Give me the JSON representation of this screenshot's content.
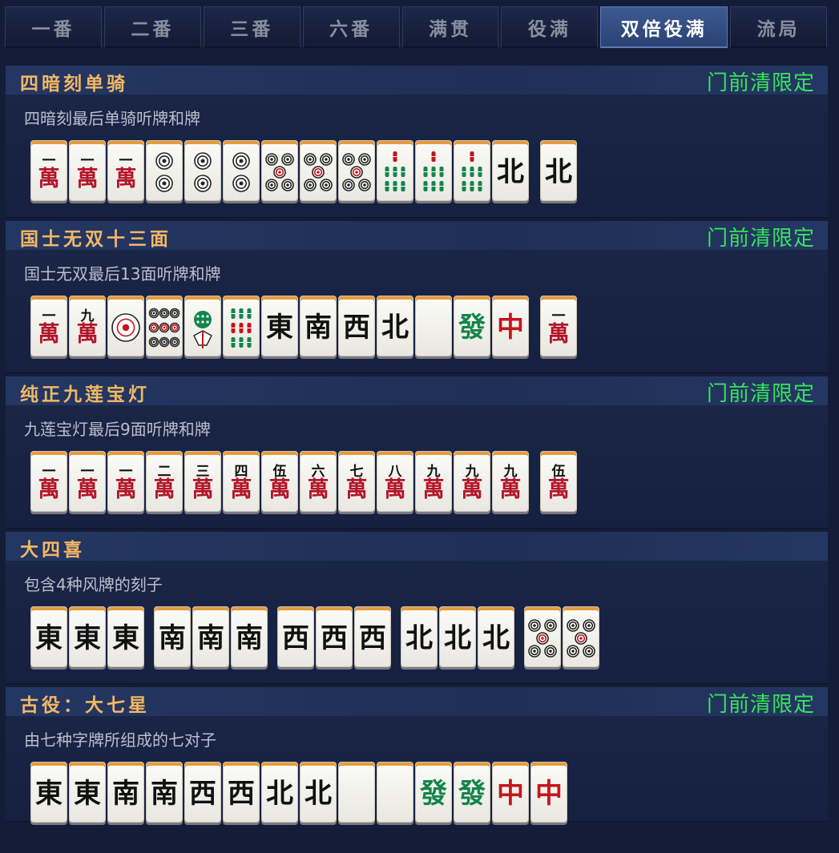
{
  "tabs": [
    {
      "label": "一番",
      "active": false
    },
    {
      "label": "二番",
      "active": false
    },
    {
      "label": "三番",
      "active": false
    },
    {
      "label": "六番",
      "active": false
    },
    {
      "label": "满贯",
      "active": false
    },
    {
      "label": "役满",
      "active": false
    },
    {
      "label": "双倍役满",
      "active": true
    },
    {
      "label": "流局",
      "active": false
    }
  ],
  "sections": [
    {
      "title": "四暗刻单骑",
      "badge": "门前清限定",
      "desc": "四暗刻最后单骑听牌和牌",
      "tiles": [
        [
          [
            "m",
            "一"
          ],
          [
            "m",
            "一"
          ],
          [
            "m",
            "一"
          ],
          [
            "p",
            2
          ],
          [
            "p",
            2
          ],
          [
            "p",
            2
          ],
          [
            "p",
            5
          ],
          [
            "p",
            5
          ],
          [
            "p",
            5
          ],
          [
            "s",
            7
          ],
          [
            "s",
            7
          ],
          [
            "s",
            7
          ],
          [
            "z",
            "北"
          ]
        ],
        [
          [
            "z",
            "北"
          ]
        ]
      ]
    },
    {
      "title": "国士无双十三面",
      "badge": "门前清限定",
      "desc": "国士无双最后13面听牌和牌",
      "tiles": [
        [
          [
            "m",
            "一"
          ],
          [
            "m",
            "九"
          ],
          [
            "p",
            1
          ],
          [
            "p",
            9
          ],
          [
            "s",
            1
          ],
          [
            "s",
            9
          ],
          [
            "z",
            "東"
          ],
          [
            "z",
            "南"
          ],
          [
            "z",
            "西"
          ],
          [
            "z",
            "北"
          ],
          [
            "z",
            ""
          ],
          [
            "g",
            "發"
          ],
          [
            "r",
            "中"
          ]
        ],
        [
          [
            "m",
            "一"
          ]
        ]
      ]
    },
    {
      "title": "纯正九莲宝灯",
      "badge": "门前清限定",
      "desc": "九莲宝灯最后9面听牌和牌",
      "tiles": [
        [
          [
            "m",
            "一"
          ],
          [
            "m",
            "一"
          ],
          [
            "m",
            "一"
          ],
          [
            "m",
            "二"
          ],
          [
            "m",
            "三"
          ],
          [
            "m",
            "四"
          ],
          [
            "m",
            "伍"
          ],
          [
            "m",
            "六"
          ],
          [
            "m",
            "七"
          ],
          [
            "m",
            "八"
          ],
          [
            "m",
            "九"
          ],
          [
            "m",
            "九"
          ],
          [
            "m",
            "九"
          ]
        ],
        [
          [
            "m",
            "伍"
          ]
        ]
      ]
    },
    {
      "title": "大四喜",
      "badge": "",
      "desc": "包含4种风牌的刻子",
      "tiles": [
        [
          [
            "z",
            "東"
          ],
          [
            "z",
            "東"
          ],
          [
            "z",
            "東"
          ]
        ],
        [
          [
            "z",
            "南"
          ],
          [
            "z",
            "南"
          ],
          [
            "z",
            "南"
          ]
        ],
        [
          [
            "z",
            "西"
          ],
          [
            "z",
            "西"
          ],
          [
            "z",
            "西"
          ]
        ],
        [
          [
            "z",
            "北"
          ],
          [
            "z",
            "北"
          ],
          [
            "z",
            "北"
          ]
        ],
        [
          [
            "p",
            5
          ],
          [
            "p",
            5
          ]
        ]
      ]
    },
    {
      "title": "古役：大七星",
      "badge": "门前清限定",
      "desc": "由七种字牌所组成的七对子",
      "tiles": [
        [
          [
            "z",
            "東"
          ],
          [
            "z",
            "東"
          ],
          [
            "z",
            "南"
          ],
          [
            "z",
            "南"
          ],
          [
            "z",
            "西"
          ],
          [
            "z",
            "西"
          ],
          [
            "z",
            "北"
          ],
          [
            "z",
            "北"
          ],
          [
            "z",
            ""
          ],
          [
            "z",
            ""
          ],
          [
            "g",
            "發"
          ],
          [
            "g",
            "發"
          ],
          [
            "r",
            "中"
          ],
          [
            "r",
            "中"
          ]
        ]
      ]
    }
  ],
  "colors": {
    "accent": "#f2b864",
    "badge": "#37e45a",
    "man_red": "#b3162a",
    "tile_face": "#fbfbf8"
  }
}
